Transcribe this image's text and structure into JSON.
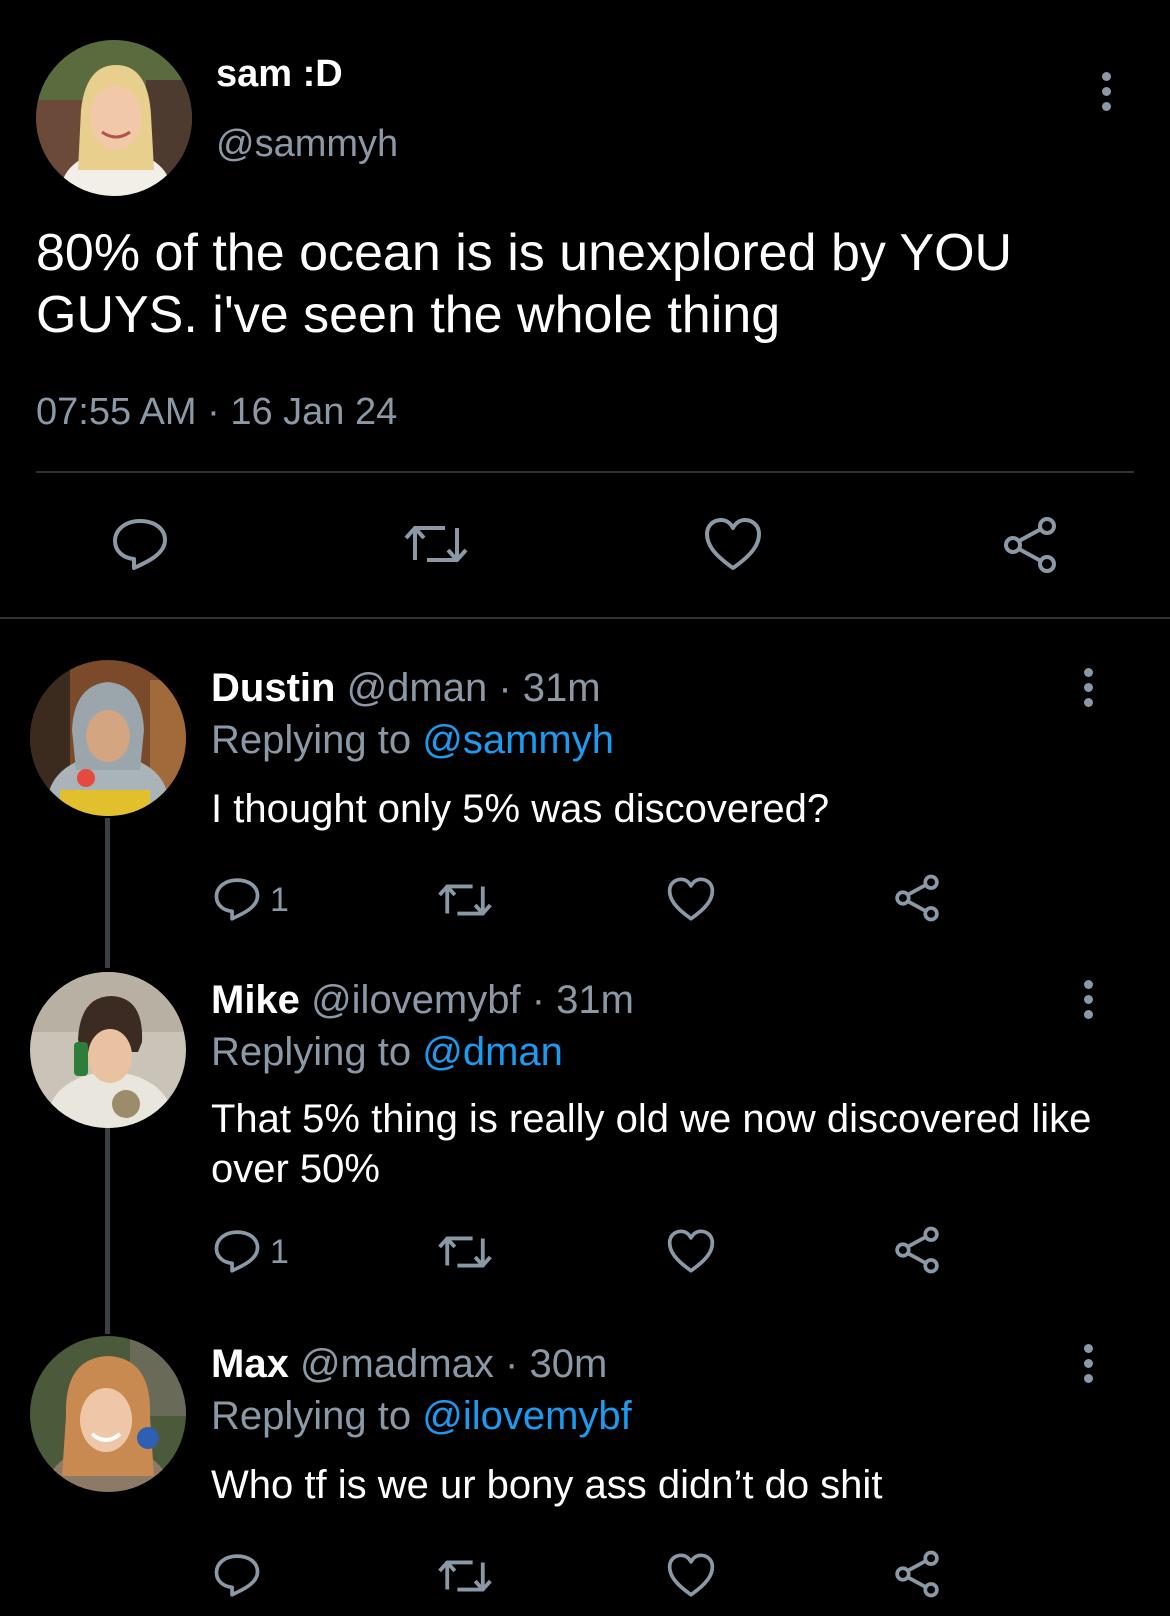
{
  "colors": {
    "background": "#000000",
    "text_primary": "#ffffff",
    "text_secondary": "#8b98a5",
    "link": "#1d9bf0",
    "divider": "#2f3336"
  },
  "main_tweet": {
    "display_name": "sam :D",
    "handle": "@sammyh",
    "text": "80% of the ocean is is unexplored by YOU GUYS. i've seen the whole thing",
    "timestamp": "07:55 AM · 16 Jan 24",
    "more_icon": "more-vertical-icon",
    "actions": [
      "reply-icon",
      "retweet-icon",
      "like-icon",
      "share-icon"
    ]
  },
  "replies": [
    {
      "display_name": "Dustin",
      "handle_time": "@dman · 31m",
      "replying_prefix": "Replying to ",
      "replying_to": "@sammyh",
      "text": "I thought only 5% was discovered?",
      "reply_count": "1"
    },
    {
      "display_name": "Mike",
      "handle_time": "@ilovemybf · 31m",
      "replying_prefix": "Replying to ",
      "replying_to": "@dman",
      "text": "That 5% thing is really old we now discovered like over 50%",
      "reply_count": "1"
    },
    {
      "display_name": "Max",
      "handle_time": "@madmax · 30m",
      "replying_prefix": "Replying to ",
      "replying_to": "@ilovemybf",
      "text": "Who tf is we ur bony ass didn’t do shit",
      "reply_count": ""
    }
  ]
}
